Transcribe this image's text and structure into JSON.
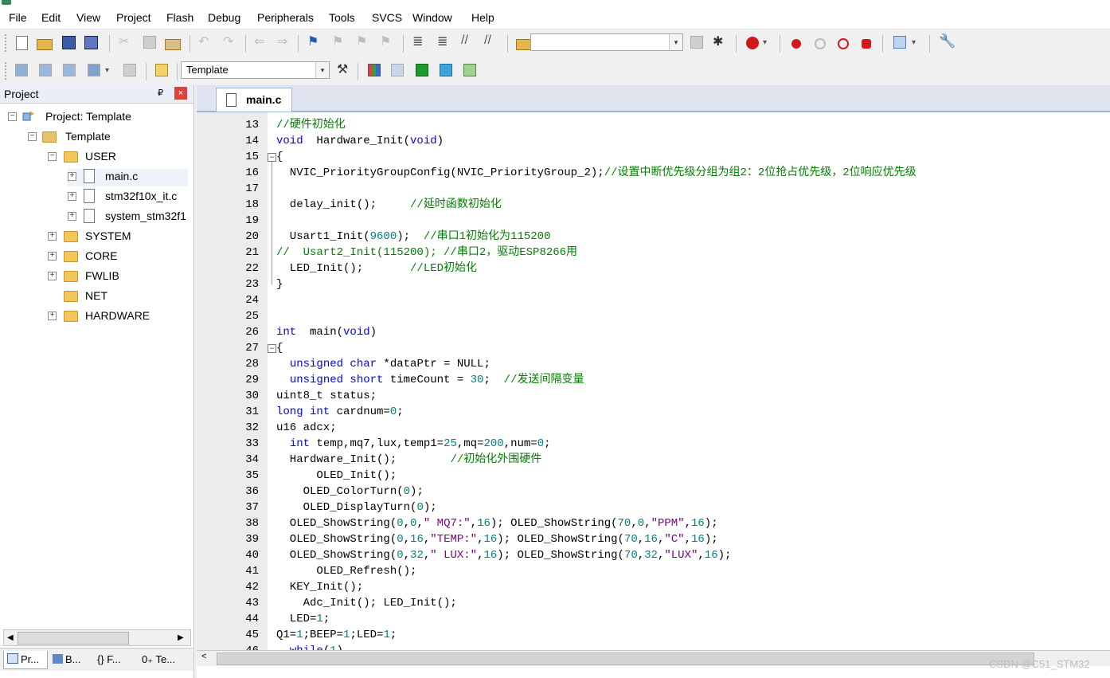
{
  "menu": [
    "File",
    "Edit",
    "View",
    "Project",
    "Flash",
    "Debug",
    "Peripherals",
    "Tools",
    "SVCS",
    "Window",
    "Help"
  ],
  "toolbar2": {
    "target": "Template"
  },
  "project_pane": {
    "title": "Project",
    "pin": "₽",
    "close": "×",
    "tree": [
      {
        "label": "Project: Template",
        "kind": "project",
        "exp": "−"
      },
      {
        "label": "Template",
        "kind": "group",
        "exp": "−"
      },
      {
        "label": "USER",
        "kind": "folder",
        "exp": "−"
      },
      {
        "label": "main.c",
        "kind": "file",
        "exp": "+"
      },
      {
        "label": "stm32f10x_it.c",
        "kind": "file",
        "exp": "+"
      },
      {
        "label": "system_stm32f1",
        "kind": "file",
        "exp": "+"
      },
      {
        "label": "SYSTEM",
        "kind": "folder",
        "exp": "+"
      },
      {
        "label": "CORE",
        "kind": "folder",
        "exp": "+"
      },
      {
        "label": "FWLIB",
        "kind": "folder",
        "exp": "+"
      },
      {
        "label": "NET",
        "kind": "folder",
        "exp": ""
      },
      {
        "label": "HARDWARE",
        "kind": "folder",
        "exp": "+"
      }
    ],
    "bottom_tabs": [
      "Pr...",
      "B...",
      "{} F...",
      "0₊ Te..."
    ]
  },
  "editor": {
    "tab": "main.c",
    "lines": [
      {
        "n": "13",
        "fold": "",
        "t": [
          [
            "c",
            "//硬件初始化"
          ]
        ]
      },
      {
        "n": "14",
        "fold": "",
        "t": [
          [
            "k",
            "void"
          ],
          [
            "",
            "  Hardware_Init("
          ],
          [
            "k",
            "void"
          ],
          [
            "",
            ")"
          ]
        ]
      },
      {
        "n": "15",
        "fold": "−",
        "t": [
          [
            "",
            "{"
          ]
        ]
      },
      {
        "n": "16",
        "fold": "",
        "t": [
          [
            "",
            "  NVIC_PriorityGroupConfig(NVIC_PriorityGroup_2);"
          ],
          [
            "c",
            "//设置中断优先级分组为组2：2位抢占优先级，2位响应优先级"
          ]
        ]
      },
      {
        "n": "17",
        "fold": "",
        "t": []
      },
      {
        "n": "18",
        "fold": "",
        "t": [
          [
            "",
            "  delay_init();     "
          ],
          [
            "c",
            "//延时函数初始化"
          ]
        ]
      },
      {
        "n": "19",
        "fold": "",
        "t": []
      },
      {
        "n": "20",
        "fold": "",
        "t": [
          [
            "",
            "  Usart1_Init("
          ],
          [
            "n",
            "9600"
          ],
          [
            "",
            "); "
          ],
          [
            "c",
            " //串口1初始化为115200"
          ]
        ]
      },
      {
        "n": "21",
        "fold": "",
        "t": [
          [
            "c",
            "//  Usart2_Init(115200); //串口2，驱动ESP8266用"
          ]
        ]
      },
      {
        "n": "22",
        "fold": "",
        "t": [
          [
            "",
            "  LED_Init();       "
          ],
          [
            "c",
            "//LED初始化"
          ]
        ]
      },
      {
        "n": "23",
        "fold": "",
        "t": [
          [
            "",
            "}"
          ]
        ]
      },
      {
        "n": "24",
        "fold": "",
        "t": []
      },
      {
        "n": "25",
        "fold": "",
        "t": []
      },
      {
        "n": "26",
        "fold": "",
        "t": [
          [
            "k",
            "int"
          ],
          [
            "",
            "  main("
          ],
          [
            "k",
            "void"
          ],
          [
            "",
            ")"
          ]
        ]
      },
      {
        "n": "27",
        "fold": "−",
        "t": [
          [
            "",
            "{"
          ]
        ]
      },
      {
        "n": "28",
        "fold": "",
        "t": [
          [
            "",
            "  "
          ],
          [
            "k",
            "unsigned char"
          ],
          [
            "",
            " *dataPtr = NULL;"
          ]
        ]
      },
      {
        "n": "29",
        "fold": "",
        "t": [
          [
            "",
            "  "
          ],
          [
            "k",
            "unsigned short"
          ],
          [
            "",
            " timeCount = "
          ],
          [
            "n",
            "30"
          ],
          [
            "",
            "; "
          ],
          [
            "c",
            " //发送间隔变量"
          ]
        ]
      },
      {
        "n": "30",
        "fold": "",
        "t": [
          [
            "",
            "uint8_t status;"
          ]
        ]
      },
      {
        "n": "31",
        "fold": "",
        "t": [
          [
            "k",
            "long int"
          ],
          [
            "",
            " cardnum="
          ],
          [
            "n",
            "0"
          ],
          [
            "",
            ";"
          ]
        ]
      },
      {
        "n": "32",
        "fold": "",
        "t": [
          [
            "",
            "u16 adcx;"
          ]
        ]
      },
      {
        "n": "33",
        "fold": "",
        "t": [
          [
            "",
            "  "
          ],
          [
            "k",
            "int"
          ],
          [
            "",
            " temp,mq7,lux,temp1="
          ],
          [
            "n",
            "25"
          ],
          [
            "",
            ",mq="
          ],
          [
            "n",
            "200"
          ],
          [
            "",
            ",num="
          ],
          [
            "n",
            "0"
          ],
          [
            "",
            ";"
          ]
        ]
      },
      {
        "n": "34",
        "fold": "",
        "t": [
          [
            "",
            "  Hardware_Init();        "
          ],
          [
            "c",
            "//初始化外围硬件"
          ]
        ]
      },
      {
        "n": "35",
        "fold": "",
        "t": [
          [
            "",
            "      OLED_Init();"
          ]
        ]
      },
      {
        "n": "36",
        "fold": "",
        "t": [
          [
            "",
            "    OLED_ColorTurn("
          ],
          [
            "n",
            "0"
          ],
          [
            "",
            ");"
          ]
        ]
      },
      {
        "n": "37",
        "fold": "",
        "t": [
          [
            "",
            "    OLED_DisplayTurn("
          ],
          [
            "n",
            "0"
          ],
          [
            "",
            ");"
          ]
        ]
      },
      {
        "n": "38",
        "fold": "",
        "t": [
          [
            "",
            "  OLED_ShowString("
          ],
          [
            "n",
            "0"
          ],
          [
            "",
            ","
          ],
          [
            "n",
            "0"
          ],
          [
            "",
            ","
          ],
          [
            "s",
            "\" MQ7:\""
          ],
          [
            "",
            ","
          ],
          [
            "n",
            "16"
          ],
          [
            "",
            "); OLED_ShowString("
          ],
          [
            "n",
            "70"
          ],
          [
            "",
            ","
          ],
          [
            "n",
            "0"
          ],
          [
            "",
            ","
          ],
          [
            "s",
            "\"PPM\""
          ],
          [
            "",
            ","
          ],
          [
            "n",
            "16"
          ],
          [
            "",
            ");"
          ]
        ]
      },
      {
        "n": "39",
        "fold": "",
        "t": [
          [
            "",
            "  OLED_ShowString("
          ],
          [
            "n",
            "0"
          ],
          [
            "",
            ","
          ],
          [
            "n",
            "16"
          ],
          [
            "",
            ","
          ],
          [
            "s",
            "\"TEMP:\""
          ],
          [
            "",
            ","
          ],
          [
            "n",
            "16"
          ],
          [
            "",
            "); OLED_ShowString("
          ],
          [
            "n",
            "70"
          ],
          [
            "",
            ","
          ],
          [
            "n",
            "16"
          ],
          [
            "",
            ","
          ],
          [
            "s",
            "\"C\""
          ],
          [
            "",
            ","
          ],
          [
            "n",
            "16"
          ],
          [
            "",
            ");"
          ]
        ]
      },
      {
        "n": "40",
        "fold": "",
        "t": [
          [
            "",
            "  OLED_ShowString("
          ],
          [
            "n",
            "0"
          ],
          [
            "",
            ","
          ],
          [
            "n",
            "32"
          ],
          [
            "",
            ","
          ],
          [
            "s",
            "\" LUX:\""
          ],
          [
            "",
            ","
          ],
          [
            "n",
            "16"
          ],
          [
            "",
            "); OLED_ShowString("
          ],
          [
            "n",
            "70"
          ],
          [
            "",
            ","
          ],
          [
            "n",
            "32"
          ],
          [
            "",
            ","
          ],
          [
            "s",
            "\"LUX\""
          ],
          [
            "",
            ","
          ],
          [
            "n",
            "16"
          ],
          [
            "",
            ");"
          ]
        ]
      },
      {
        "n": "41",
        "fold": "",
        "t": [
          [
            "",
            "      OLED_Refresh();"
          ]
        ]
      },
      {
        "n": "42",
        "fold": "",
        "t": [
          [
            "",
            "  KEY_Init();"
          ]
        ]
      },
      {
        "n": "43",
        "fold": "",
        "t": [
          [
            "",
            "    Adc_Init(); LED_Init();"
          ]
        ]
      },
      {
        "n": "44",
        "fold": "",
        "t": [
          [
            "",
            "  LED="
          ],
          [
            "n",
            "1"
          ],
          [
            "",
            ";"
          ]
        ]
      },
      {
        "n": "45",
        "fold": "",
        "t": [
          [
            "",
            "Q1="
          ],
          [
            "n",
            "1"
          ],
          [
            "",
            ";BEEP="
          ],
          [
            "n",
            "1"
          ],
          [
            "",
            ";LED="
          ],
          [
            "n",
            "1"
          ],
          [
            "",
            ";"
          ]
        ]
      },
      {
        "n": "46",
        "fold": "",
        "t": [
          [
            "",
            "  "
          ],
          [
            "k",
            "while"
          ],
          [
            "",
            "("
          ],
          [
            "n",
            "1"
          ],
          [
            "",
            ")"
          ]
        ]
      }
    ]
  },
  "watermark": "CSDN @C51_STM32"
}
